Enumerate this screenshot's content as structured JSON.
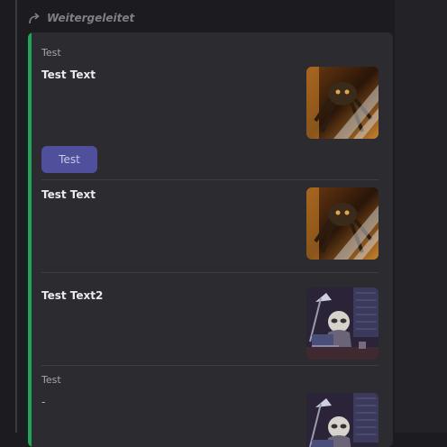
{
  "forwarded_label": "Weitergeleitet",
  "accent_color": "#23a559",
  "button_color": "#4f4f9c",
  "embeds": [
    {
      "author": "Test",
      "title": "Test Text",
      "button_label": "Test",
      "thumbnail": "spider-robot-image"
    },
    {
      "title": "Test Text",
      "thumbnail": "spider-robot-image"
    },
    {
      "title": "Test Text2",
      "thumbnail": "sloth-laptop-image"
    },
    {
      "author": "Test",
      "description": "-",
      "thumbnail": "sloth-laptop-image"
    }
  ]
}
